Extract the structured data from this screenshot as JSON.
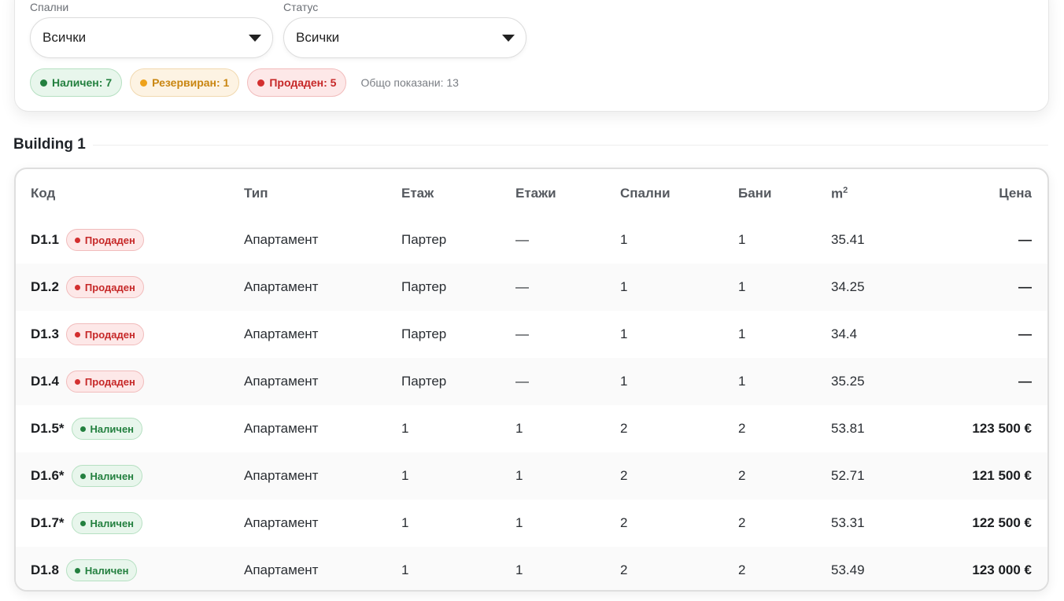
{
  "filters": {
    "bedrooms": {
      "label": "Спални",
      "value": "Всички"
    },
    "status": {
      "label": "Статус",
      "value": "Всички"
    }
  },
  "summary": {
    "available": "Наличен: 7",
    "reserved": "Резервиран: 1",
    "sold": "Продаден: 5",
    "total": "Общо показани: 13"
  },
  "colors": {
    "available": "#23803f",
    "reserved": "#eea21b",
    "sold": "#d32f2f"
  },
  "section": {
    "title": "Building 1"
  },
  "table": {
    "headers": {
      "code": "Код",
      "type": "Тип",
      "floor": "Етаж",
      "floors": "Етажи",
      "bedrooms": "Спални",
      "bathrooms": "Бани",
      "area": "m",
      "area_sup": "2",
      "price": "Цена"
    },
    "rows": [
      {
        "code": "D1.1",
        "status": "Продаден",
        "status_kind": "sold",
        "type": "Апартамент",
        "floor": "Партер",
        "floors": "—",
        "bedrooms": "1",
        "bathrooms": "1",
        "area": "35.41",
        "price": "—"
      },
      {
        "code": "D1.2",
        "status": "Продаден",
        "status_kind": "sold",
        "type": "Апартамент",
        "floor": "Партер",
        "floors": "—",
        "bedrooms": "1",
        "bathrooms": "1",
        "area": "34.25",
        "price": "—"
      },
      {
        "code": "D1.3",
        "status": "Продаден",
        "status_kind": "sold",
        "type": "Апартамент",
        "floor": "Партер",
        "floors": "—",
        "bedrooms": "1",
        "bathrooms": "1",
        "area": "34.4",
        "price": "—"
      },
      {
        "code": "D1.4",
        "status": "Продаден",
        "status_kind": "sold",
        "type": "Апартамент",
        "floor": "Партер",
        "floors": "—",
        "bedrooms": "1",
        "bathrooms": "1",
        "area": "35.25",
        "price": "—"
      },
      {
        "code": "D1.5*",
        "status": "Наличен",
        "status_kind": "avail",
        "type": "Апартамент",
        "floor": "1",
        "floors": "1",
        "bedrooms": "2",
        "bathrooms": "2",
        "area": "53.81",
        "price": "123 500 €"
      },
      {
        "code": "D1.6*",
        "status": "Наличен",
        "status_kind": "avail",
        "type": "Апартамент",
        "floor": "1",
        "floors": "1",
        "bedrooms": "2",
        "bathrooms": "2",
        "area": "52.71",
        "price": "121 500 €"
      },
      {
        "code": "D1.7*",
        "status": "Наличен",
        "status_kind": "avail",
        "type": "Апартамент",
        "floor": "1",
        "floors": "1",
        "bedrooms": "2",
        "bathrooms": "2",
        "area": "53.31",
        "price": "122 500 €"
      },
      {
        "code": "D1.8",
        "status": "Наличен",
        "status_kind": "avail",
        "type": "Апартамент",
        "floor": "1",
        "floors": "1",
        "bedrooms": "2",
        "bathrooms": "2",
        "area": "53.49",
        "price": "123 000 €"
      }
    ]
  }
}
